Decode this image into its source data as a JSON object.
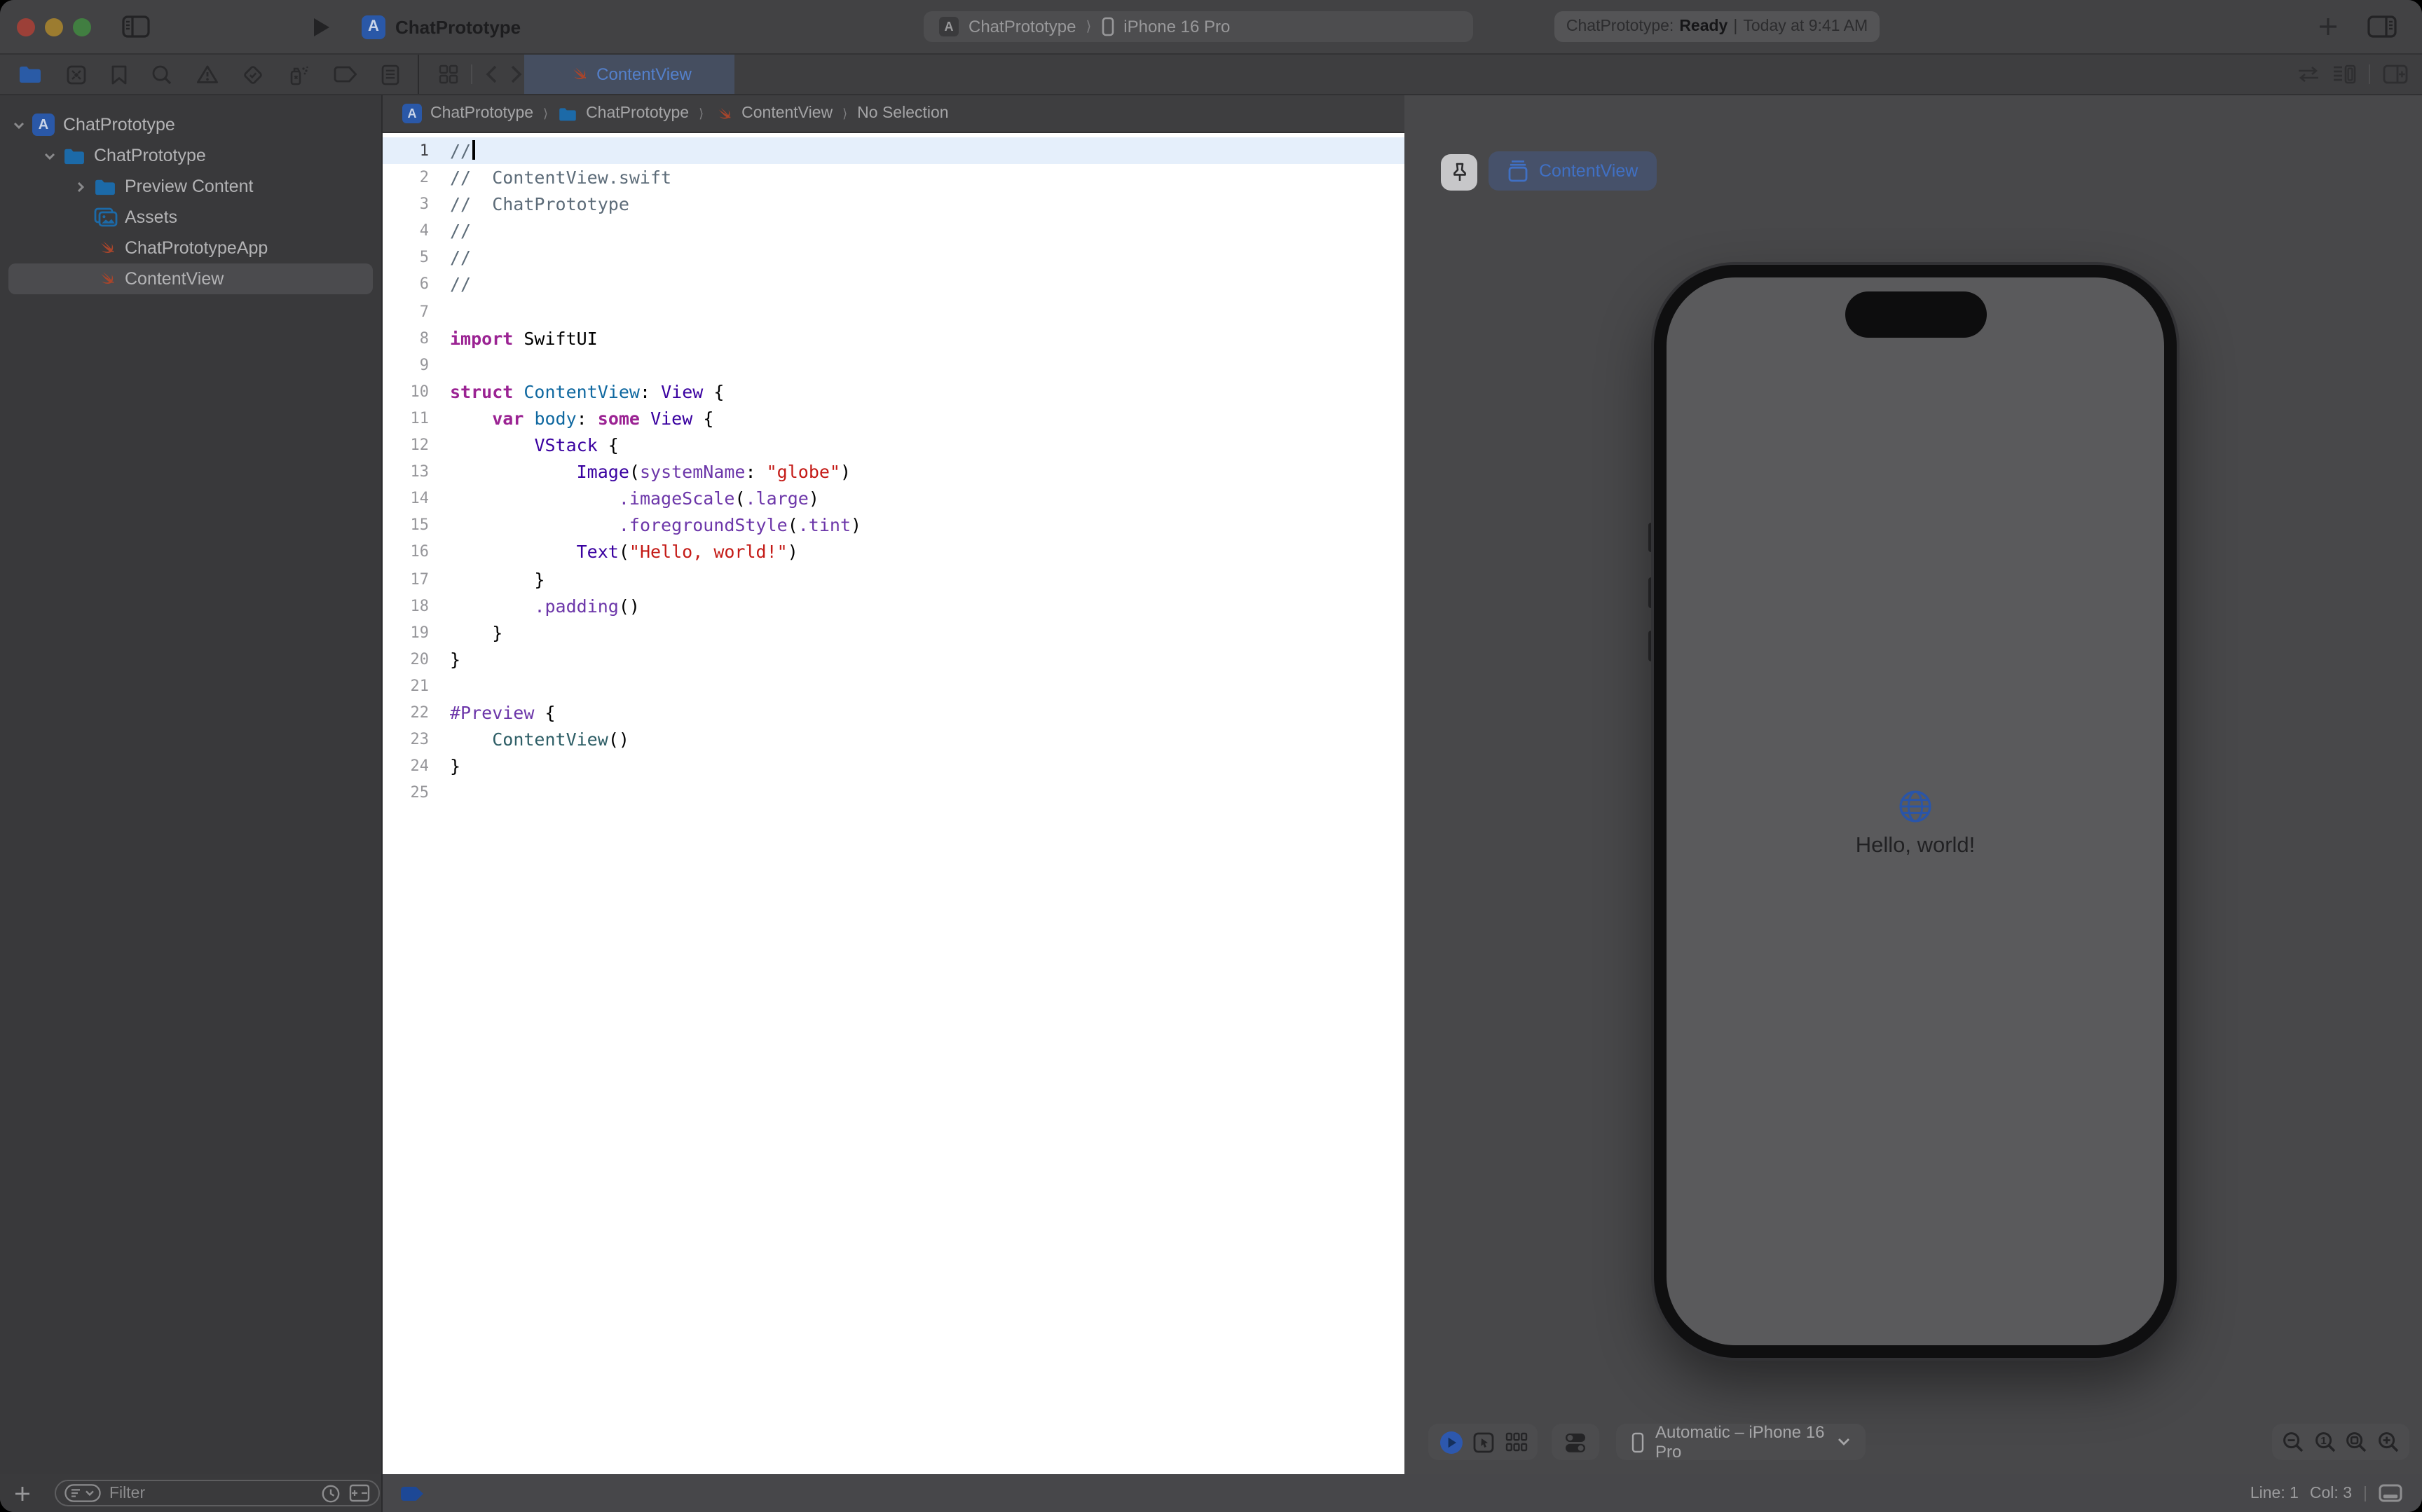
{
  "window": {
    "title": "ChatPrototype"
  },
  "titlebar": {
    "scheme": {
      "project": "ChatPrototype",
      "separator": "⟩",
      "destination": "iPhone 16 Pro"
    },
    "status": {
      "project_label": "ChatPrototype:",
      "state": "Ready",
      "sep": "|",
      "detail": "Today at 9:41 AM"
    }
  },
  "tabbar": {
    "tab_label": "ContentView"
  },
  "jumpbar": {
    "items": [
      "ChatPrototype",
      "ChatPrototype",
      "ContentView",
      "No Selection"
    ],
    "chevron": "⟩"
  },
  "sidebar": {
    "items": [
      {
        "label": "ChatPrototype",
        "icon": "app",
        "depth": 0,
        "disclosure": "open"
      },
      {
        "label": "ChatPrototype",
        "icon": "folder",
        "depth": 1,
        "disclosure": "open"
      },
      {
        "label": "Preview Content",
        "icon": "folder",
        "depth": 2,
        "disclosure": "closed"
      },
      {
        "label": "Assets",
        "icon": "assets",
        "depth": 2
      },
      {
        "label": "ChatPrototypeApp",
        "icon": "swift",
        "depth": 2
      },
      {
        "label": "ContentView",
        "icon": "swift",
        "depth": 2,
        "selected": true
      }
    ]
  },
  "editor": {
    "syntax_colors": {
      "p": "#000000",
      "c": "#5D6C79",
      "k": "#9B2393",
      "s": "#C41A16",
      "d": "#0F68A0",
      "t": "#3900A0",
      "m": "#6C36A9",
      "r": "#2E5E66"
    },
    "lines": [
      {
        "n": 1,
        "current": true,
        "tokens": [
          [
            "c",
            "//"
          ]
        ]
      },
      {
        "n": 2,
        "tokens": [
          [
            "c",
            "//  ContentView.swift"
          ]
        ]
      },
      {
        "n": 3,
        "tokens": [
          [
            "c",
            "//  ChatPrototype"
          ]
        ]
      },
      {
        "n": 4,
        "tokens": [
          [
            "c",
            "//"
          ]
        ]
      },
      {
        "n": 5,
        "tokens": [
          [
            "c",
            "//"
          ]
        ]
      },
      {
        "n": 6,
        "tokens": [
          [
            "c",
            "//"
          ]
        ]
      },
      {
        "n": 7,
        "tokens": []
      },
      {
        "n": 8,
        "tokens": [
          [
            "k",
            "import"
          ],
          [
            "p",
            " SwiftUI"
          ]
        ]
      },
      {
        "n": 9,
        "tokens": []
      },
      {
        "n": 10,
        "tokens": [
          [
            "k",
            "struct"
          ],
          [
            "p",
            " "
          ],
          [
            "d",
            "ContentView"
          ],
          [
            "p",
            ": "
          ],
          [
            "t",
            "View"
          ],
          [
            "p",
            " {"
          ]
        ]
      },
      {
        "n": 11,
        "tokens": [
          [
            "p",
            "    "
          ],
          [
            "k",
            "var"
          ],
          [
            "p",
            " "
          ],
          [
            "d",
            "body"
          ],
          [
            "p",
            ": "
          ],
          [
            "k",
            "some"
          ],
          [
            "p",
            " "
          ],
          [
            "t",
            "View"
          ],
          [
            "p",
            " {"
          ]
        ]
      },
      {
        "n": 12,
        "tokens": [
          [
            "p",
            "        "
          ],
          [
            "t",
            "VStack"
          ],
          [
            "p",
            " {"
          ]
        ]
      },
      {
        "n": 13,
        "tokens": [
          [
            "p",
            "            "
          ],
          [
            "t",
            "Image"
          ],
          [
            "p",
            "("
          ],
          [
            "m",
            "systemName"
          ],
          [
            "p",
            ": "
          ],
          [
            "s",
            "\"globe\""
          ],
          [
            "p",
            ")"
          ]
        ]
      },
      {
        "n": 14,
        "tokens": [
          [
            "p",
            "                "
          ],
          [
            "m",
            ".imageScale"
          ],
          [
            "p",
            "("
          ],
          [
            "m",
            ".large"
          ],
          [
            "p",
            ")"
          ]
        ]
      },
      {
        "n": 15,
        "tokens": [
          [
            "p",
            "                "
          ],
          [
            "m",
            ".foregroundStyle"
          ],
          [
            "p",
            "("
          ],
          [
            "m",
            ".tint"
          ],
          [
            "p",
            ")"
          ]
        ]
      },
      {
        "n": 16,
        "tokens": [
          [
            "p",
            "            "
          ],
          [
            "t",
            "Text"
          ],
          [
            "p",
            "("
          ],
          [
            "s",
            "\"Hello, world!\""
          ],
          [
            "p",
            ")"
          ]
        ]
      },
      {
        "n": 17,
        "tokens": [
          [
            "p",
            "        }"
          ]
        ]
      },
      {
        "n": 18,
        "tokens": [
          [
            "p",
            "        "
          ],
          [
            "m",
            ".padding"
          ],
          [
            "p",
            "()"
          ]
        ]
      },
      {
        "n": 19,
        "tokens": [
          [
            "p",
            "    }"
          ]
        ]
      },
      {
        "n": 20,
        "tokens": [
          [
            "p",
            "}"
          ]
        ]
      },
      {
        "n": 21,
        "tokens": []
      },
      {
        "n": 22,
        "tokens": [
          [
            "m",
            "#Preview"
          ],
          [
            "p",
            " {"
          ]
        ]
      },
      {
        "n": 23,
        "tokens": [
          [
            "p",
            "    "
          ],
          [
            "r",
            "ContentView"
          ],
          [
            "p",
            "()"
          ]
        ]
      },
      {
        "n": 24,
        "tokens": [
          [
            "p",
            "}"
          ]
        ]
      },
      {
        "n": 25,
        "tokens": []
      }
    ]
  },
  "canvas": {
    "preview_pill_label": "ContentView",
    "device_label": "Automatic – iPhone 16 Pro",
    "hello_text": "Hello, world!"
  },
  "statusbar": {
    "filter_placeholder": "Filter",
    "line_label": "Line: 1",
    "col_label": "Col: 3",
    "sep": "|"
  },
  "colors": {
    "chrome": "#424244",
    "sidebar_bg": "#39393B",
    "canvas_bg": "#48484A",
    "editor_bg": "#FFFFFF",
    "current_line": "#E5EFFB",
    "tab_active_bg": "#454E60",
    "tab_label_blue": "#5480CB",
    "accent_blue": "#2D58AE",
    "globe_blue": "#2A55A8",
    "swift_orange": "#A8452B",
    "folder_blue": "#1C6AA8",
    "breakpoint_blue": "#1D4896",
    "phone_screen": "#5A5A5C"
  }
}
